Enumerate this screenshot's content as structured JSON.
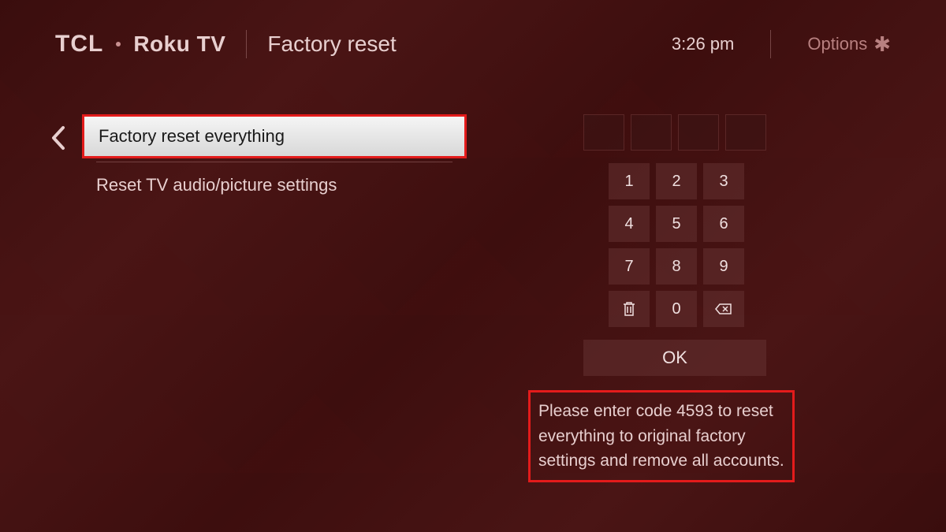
{
  "header": {
    "brand1": "TCL",
    "brand2": "Roku TV",
    "title": "Factory reset",
    "clock": "3:26  pm",
    "options_label": "Options"
  },
  "menu": {
    "items": [
      {
        "label": "Factory reset everything",
        "selected": true
      },
      {
        "label": "Reset TV audio/picture settings",
        "selected": false
      }
    ]
  },
  "keypad": {
    "keys": [
      "1",
      "2",
      "3",
      "4",
      "5",
      "6",
      "7",
      "8",
      "9"
    ],
    "zero": "0",
    "ok": "OK"
  },
  "instruction": "Please enter code 4593 to reset everything to original factory settings and remove all accounts."
}
